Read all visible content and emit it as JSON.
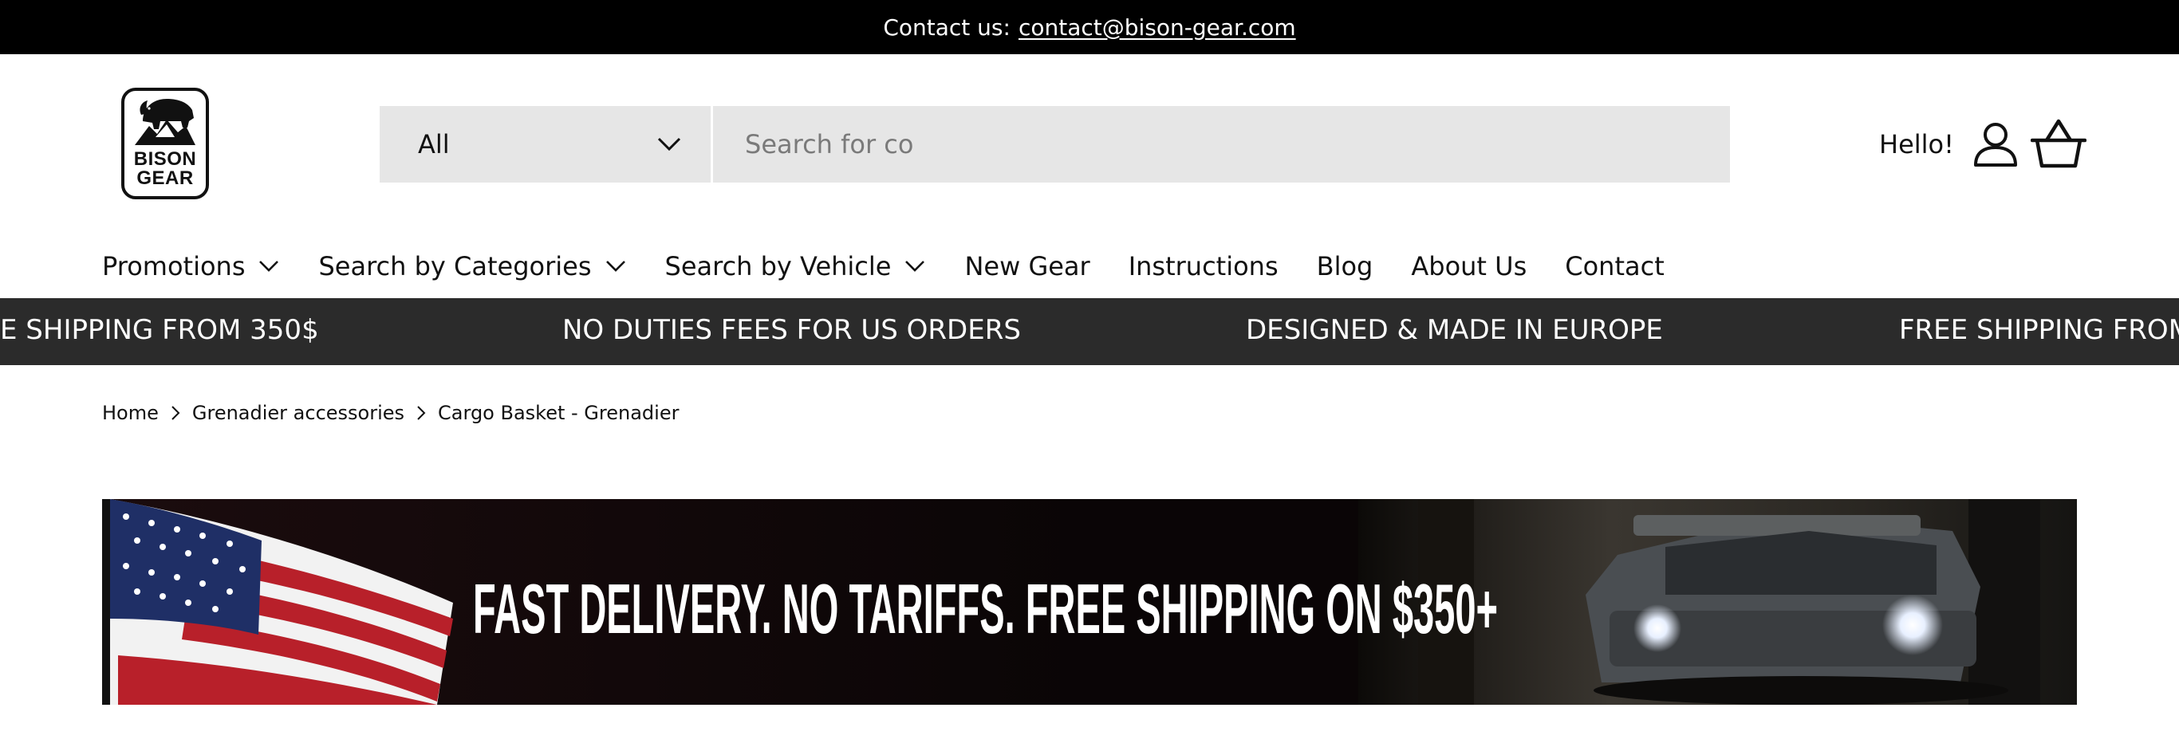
{
  "topbar": {
    "contact_label": "Contact us:",
    "contact_email": "contact@bison-gear.com"
  },
  "logo": {
    "line1": "BISON",
    "line2": "GEAR",
    "icon": "bison-icon"
  },
  "search": {
    "category": "All",
    "value": "Search for co",
    "placeholder": "Search for co"
  },
  "account": {
    "greeting": "Hello!",
    "icon": "user-icon"
  },
  "cart": {
    "icon": "basket-icon"
  },
  "nav": {
    "items": [
      {
        "label": "Promotions"
      },
      {
        "label": "Search by Categories"
      },
      {
        "label": "Search by Vehicle"
      },
      {
        "label": "New Gear"
      },
      {
        "label": "Instructions"
      },
      {
        "label": "Blog"
      },
      {
        "label": "About Us"
      },
      {
        "label": "Contact"
      }
    ]
  },
  "marquee": {
    "items": [
      "E SHIPPING FROM 350$",
      "NO DUTIES FEES FOR US ORDERS",
      "DESIGNED & MADE IN EUROPE",
      "FREE SHIPPING FROM"
    ]
  },
  "breadcrumb": {
    "items": [
      "Home",
      "Grenadier accessories",
      "Cargo Basket - Grenadier"
    ]
  },
  "banner": {
    "headline": "FAST DELIVERY. NO TARIFFS. FREE SHIPPING ON $350+"
  },
  "colors": {
    "topbar": "#000000",
    "marquee": "#2b2b2b",
    "search_bg": "#e6e6e6",
    "banner_bg": "#0a0506"
  }
}
